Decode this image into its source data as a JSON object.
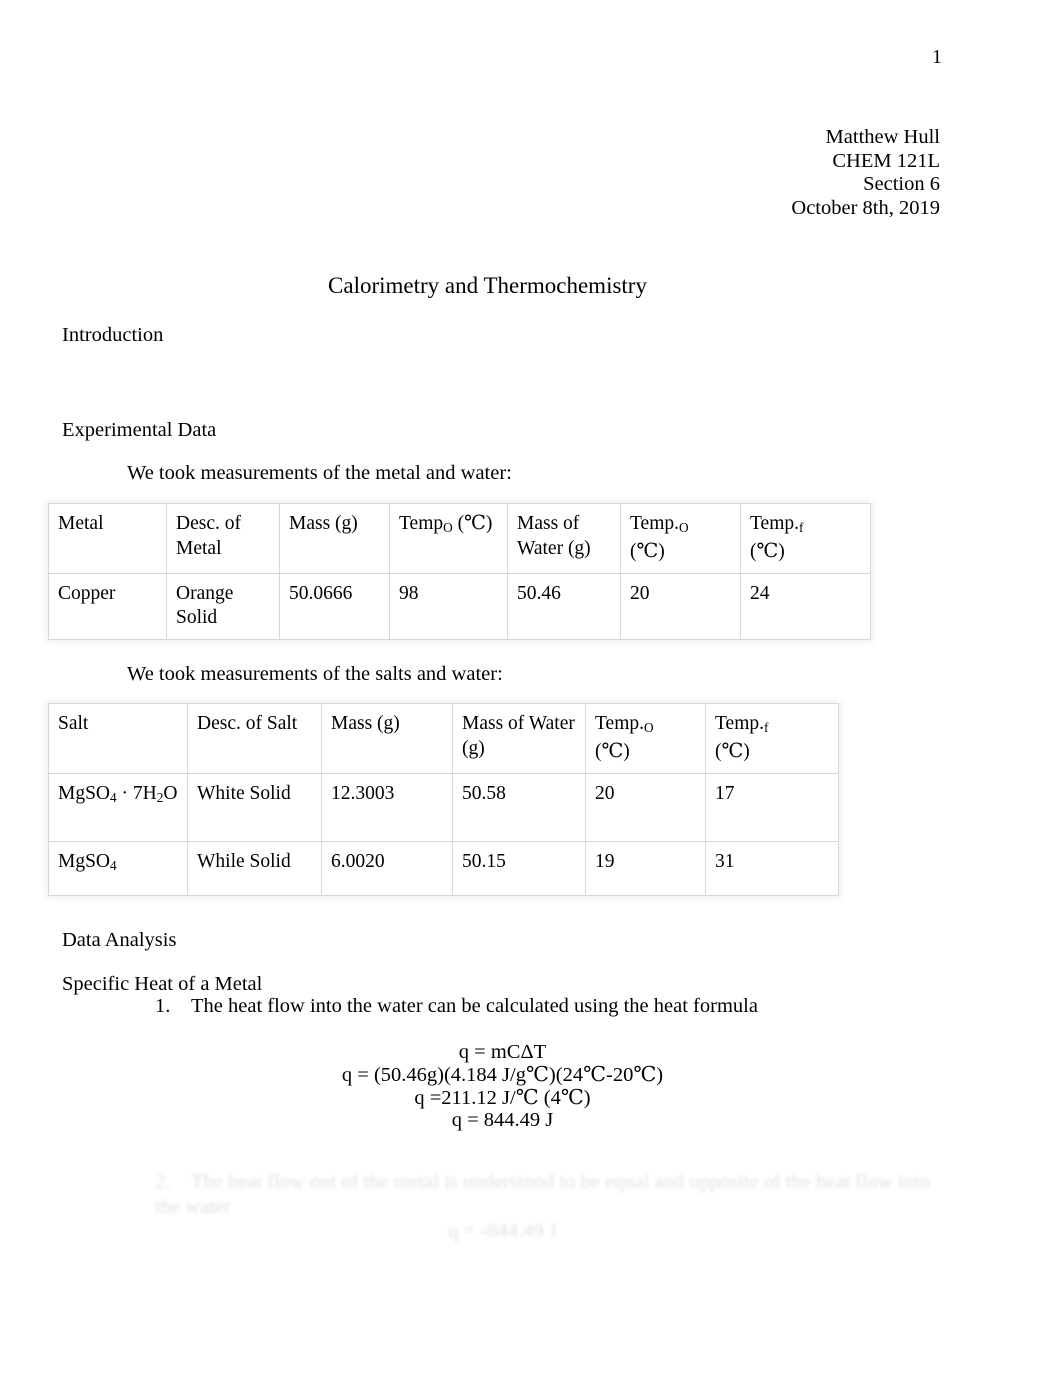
{
  "document": {
    "page_number": "1",
    "title": "Calorimetry and Thermochemistry"
  },
  "header": {
    "author": "Matthew Hull",
    "course": "CHEM 121L",
    "section": "Section 6",
    "date": "October 8th, 2019"
  },
  "sections": {
    "introduction_heading": "Introduction",
    "experimental_data_heading": "Experimental Data",
    "data_analysis_heading": "Data Analysis",
    "specific_heat_heading": "Specific Heat of a Metal"
  },
  "leads": {
    "metal_lead": "We took measurements of the metal and water:",
    "salt_lead": "We took measurements of the salts and water:"
  },
  "metal_table": {
    "headers": {
      "c1": "Metal",
      "c2": "Desc. of Metal",
      "c3": "Mass (g)",
      "c4_main": "Temp",
      "c4_sub": "O",
      "c4_tail": " (℃)",
      "c5": "Mass of Water (g)",
      "c6_main": "Temp.",
      "c6_sub": "O",
      "c6_tail": "(℃)",
      "c7_main": "Temp.",
      "c7_sub": "f",
      "c7_tail": "(℃)"
    },
    "rows": [
      {
        "metal": "Copper",
        "description": "Orange Solid",
        "mass_g": "50.0666",
        "temp_o_metal_c": "98",
        "mass_water_g": "50.46",
        "temp_o_water_c": "20",
        "temp_f_c": "24"
      }
    ]
  },
  "salt_table": {
    "headers": {
      "c1": "Salt",
      "c2": "Desc. of Salt",
      "c3": "Mass (g)",
      "c4": "Mass of Water (g)",
      "c5_main": "Temp.",
      "c5_sub": "O",
      "c5_tail": "(℃)",
      "c6_main": "Temp.",
      "c6_sub": "f",
      "c6_tail": "(℃)"
    },
    "rows": [
      {
        "salt_main": "MgSO",
        "salt_sub": "4",
        "salt_mid": "  · 7H",
        "salt_sub2": "2",
        "salt_tail": "O",
        "description": "White Solid",
        "mass_g": "12.3003",
        "mass_water_g": "50.58",
        "temp_o_c": "20",
        "temp_f_c": "17"
      },
      {
        "salt_main": "MgSO",
        "salt_sub": "4",
        "salt_mid": "",
        "salt_sub2": "",
        "salt_tail": "",
        "description": "While Solid",
        "mass_g": "6.0020",
        "mass_water_g": "50.15",
        "temp_o_c": "19",
        "temp_f_c": "31"
      }
    ]
  },
  "analysis": {
    "item_1_number": "1.",
    "item_1_text": "The heat flow into the water can be calculated using the heat formula",
    "equations": [
      "q = mCΔT",
      "q = (50.46g)(4.184 J/g℃)(24℃-20℃)",
      "q =211.12 J/℃ (4℃)",
      "q = 844.49 J"
    ],
    "item_2_number": "2.",
    "item_2_text": "The heat flow out of the metal is understood to be equal and opposite of the heat flow into the water",
    "item_2_equation": "q = -844.49 J"
  }
}
